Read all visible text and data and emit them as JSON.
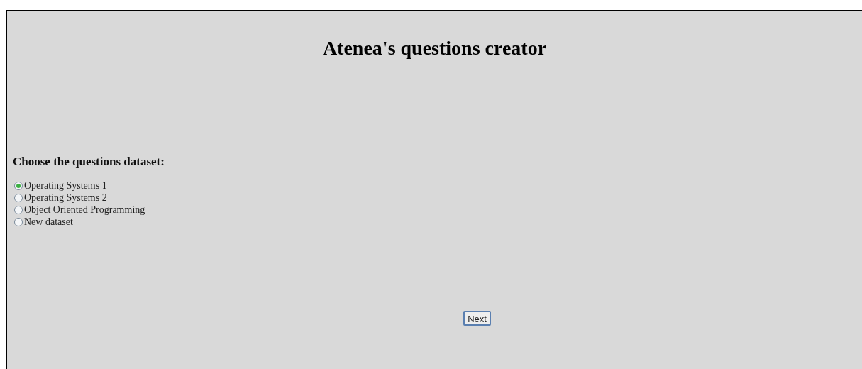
{
  "title": "Atenea's questions creator",
  "prompt": "Choose the questions dataset:",
  "options": [
    {
      "label": "Operating Systems 1",
      "selected": true
    },
    {
      "label": "Operating Systems 2",
      "selected": false
    },
    {
      "label": "Object Oriented Programming",
      "selected": false
    },
    {
      "label": "New dataset",
      "selected": false
    }
  ],
  "button": "Next"
}
